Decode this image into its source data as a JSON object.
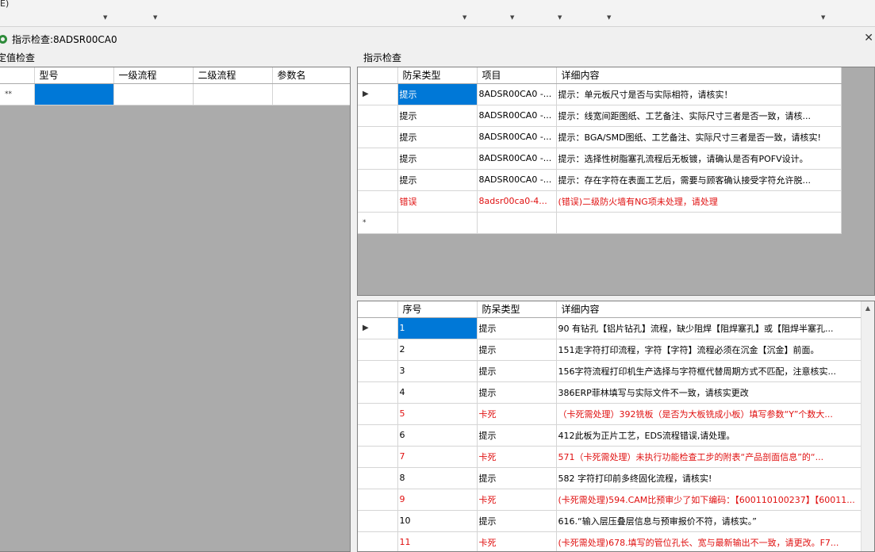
{
  "menu": {
    "fragment": "E)"
  },
  "window": {
    "title": "指示检查:8ADSR00CA0",
    "close_glyph": "✕"
  },
  "left_panel": {
    "label": "定值检查",
    "columns": [
      "型号",
      "一级流程",
      "二级流程",
      "参数名"
    ],
    "new_row_marker": "**"
  },
  "right_panel": {
    "label": "指示检查"
  },
  "top_grid": {
    "columns": [
      "防呆类型",
      "项目",
      "详细内容"
    ],
    "rows": [
      {
        "type": "提示",
        "item": "8ADSR00CA0 -...",
        "detail": "提示：单元板尺寸是否与实际相符，请核实！",
        "error": false
      },
      {
        "type": "提示",
        "item": "8ADSR00CA0 -...",
        "detail": "提示：线宽间距图纸、工艺备注、实际尺寸三者是否一致，请核...",
        "error": false
      },
      {
        "type": "提示",
        "item": "8ADSR00CA0 -...",
        "detail": "提示：BGA/SMD图纸、工艺备注、实际尺寸三者是否一致，请核实!",
        "error": false
      },
      {
        "type": "提示",
        "item": "8ADSR00CA0 -...",
        "detail": "提示：选择性树脂塞孔流程后无板镀，请确认是否有POFV设计。",
        "error": false
      },
      {
        "type": "提示",
        "item": "8ADSR00CA0 -...",
        "detail": "提示：存在字符在表面工艺后，需要与顾客确认接受字符允许脱...",
        "error": false
      },
      {
        "type": "错误",
        "item": "8adsr00ca0-4...",
        "detail": "(错误)二级防火墙有NG项未处理，请处理",
        "error": true
      }
    ],
    "current_marker": "▶",
    "new_row_marker": "*"
  },
  "bottom_grid": {
    "columns": [
      "序号",
      "防呆类型",
      "详细内容"
    ],
    "rows": [
      {
        "no": "1",
        "type": "提示",
        "detail": "90 有钻孔【铝片钻孔】流程，缺少阻焊【阻焊塞孔】或【阻焊半塞孔...",
        "error": false
      },
      {
        "no": "2",
        "type": "提示",
        "detail": "151走字符打印流程，字符【字符】流程必须在沉金【沉金】前面。",
        "error": false
      },
      {
        "no": "3",
        "type": "提示",
        "detail": "156字符流程打印机生产选择与字符框代替周期方式不匹配，注意核实...",
        "error": false
      },
      {
        "no": "4",
        "type": "提示",
        "detail": "386ERP菲林填写与实际文件不一致，请核实更改",
        "error": false
      },
      {
        "no": "5",
        "type": "卡死",
        "detail": "（卡死需处理）392铣板（是否为大板铣成小板）填写参数“Y”个数大...",
        "error": true
      },
      {
        "no": "6",
        "type": "提示",
        "detail": "412此板为正片工艺，EDS流程错误,请处理。",
        "error": false
      },
      {
        "no": "7",
        "type": "卡死",
        "detail": "571（卡死需处理）未执行功能检查工步的附表“产品剖面信息”的“...",
        "error": true
      },
      {
        "no": "8",
        "type": "提示",
        "detail": "582 字符打印前多终固化流程，请核实!",
        "error": false
      },
      {
        "no": "9",
        "type": "卡死",
        "detail": "(卡死需处理)594.CAM比预审少了如下编码：【600110100237】【60011...",
        "error": true
      },
      {
        "no": "10",
        "type": "提示",
        "detail": "616.“输入层压叠层信息与预审报价不符，请核实。”",
        "error": false
      },
      {
        "no": "11",
        "type": "卡死",
        "detail": "(卡死需处理)678.填写的管位孔长、宽与最新输出不一致，请更改。F7...",
        "error": true
      }
    ],
    "current_marker": "▶"
  },
  "colors": {
    "selection": "#0078d7",
    "error_text": "#e01010",
    "grid_background": "#ababab"
  }
}
